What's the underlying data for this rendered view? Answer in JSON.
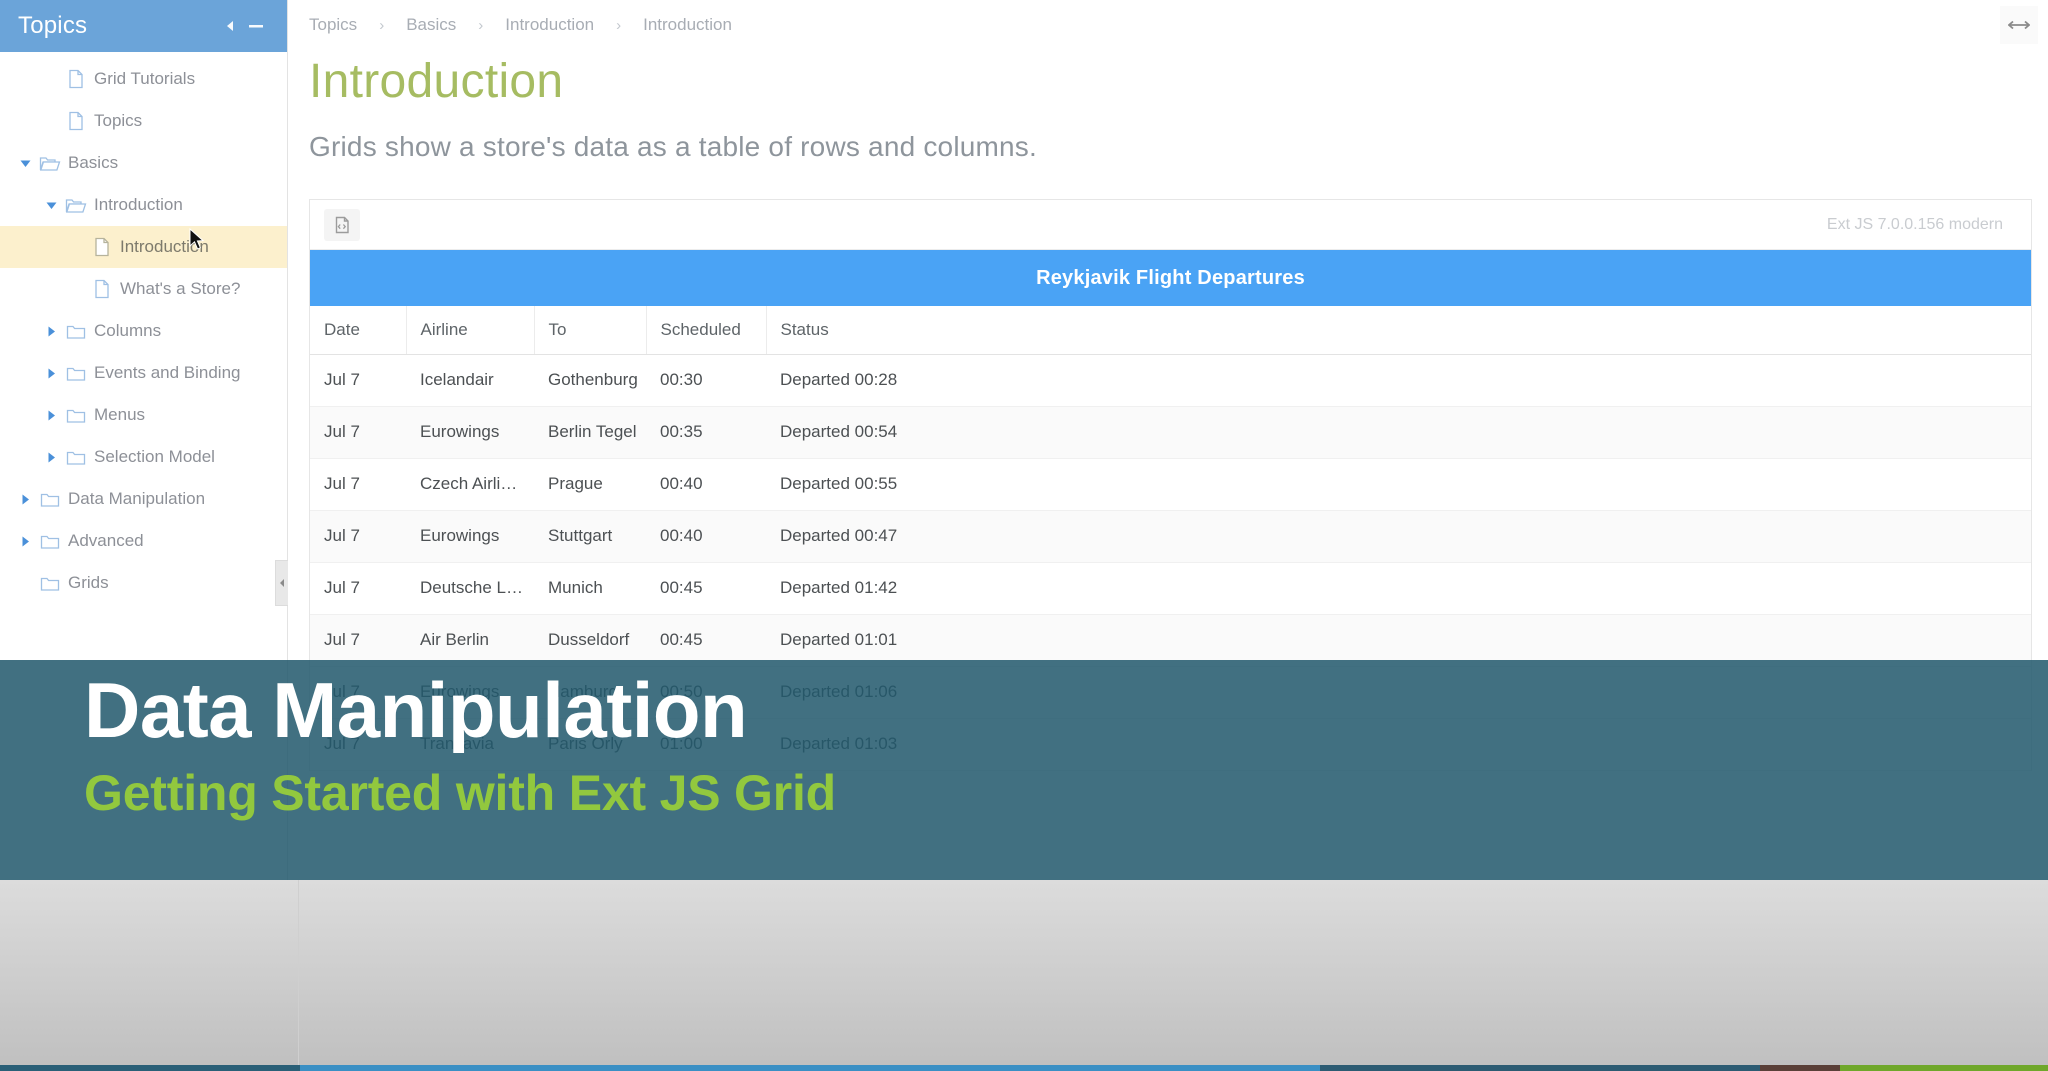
{
  "sidebar": {
    "title": "Topics",
    "collapse_icon": "caret-left-icon",
    "minimize_icon": "minus-icon",
    "collapse_handle_icon": "caret-left-icon",
    "items": [
      {
        "label": "Grid Tutorials",
        "icon": "file-icon",
        "indent": 1,
        "arrow": "none",
        "selected": false
      },
      {
        "label": "Topics",
        "icon": "file-icon",
        "indent": 1,
        "arrow": "none",
        "selected": false
      },
      {
        "label": "Basics",
        "icon": "folder-open-icon",
        "indent": 0,
        "arrow": "expanded",
        "selected": false
      },
      {
        "label": "Introduction",
        "icon": "folder-open-icon",
        "indent": 1,
        "arrow": "expanded",
        "selected": false
      },
      {
        "label": "Introduction",
        "icon": "file-icon",
        "indent": 2,
        "arrow": "none",
        "selected": true
      },
      {
        "label": "What's a Store?",
        "icon": "file-icon",
        "indent": 2,
        "arrow": "none",
        "selected": false
      },
      {
        "label": "Columns",
        "icon": "folder-icon",
        "indent": 1,
        "arrow": "collapsed",
        "selected": false
      },
      {
        "label": "Events and Binding",
        "icon": "folder-icon",
        "indent": 1,
        "arrow": "collapsed",
        "selected": false
      },
      {
        "label": "Menus",
        "icon": "folder-icon",
        "indent": 1,
        "arrow": "collapsed",
        "selected": false
      },
      {
        "label": "Selection Model",
        "icon": "folder-icon",
        "indent": 1,
        "arrow": "collapsed",
        "selected": false
      },
      {
        "label": "Data Manipulation",
        "icon": "folder-icon",
        "indent": 0,
        "arrow": "collapsed",
        "selected": false
      },
      {
        "label": "Advanced",
        "icon": "folder-icon",
        "indent": 0,
        "arrow": "collapsed",
        "selected": false
      },
      {
        "label": "Grids",
        "icon": "folder-icon",
        "indent": 0,
        "arrow": "none",
        "selected": false
      }
    ]
  },
  "breadcrumb": {
    "separator": "›",
    "items": [
      "Topics",
      "Basics",
      "Introduction",
      "Introduction"
    ]
  },
  "topbar": {
    "resize_icon": "horizontal-resize-icon"
  },
  "doc": {
    "title": "Introduction",
    "subtitle": "Grids show a store's data as a table of rows and columns."
  },
  "example": {
    "code_button_icon": "file-code-icon",
    "version_label": "Ext JS 7.0.0.156 modern"
  },
  "grid": {
    "title": "Reykjavik Flight Departures",
    "accent_color": "#4aa3f5",
    "columns": [
      "Date",
      "Airline",
      "To",
      "Scheduled",
      "Status"
    ],
    "rows": [
      [
        "Jul 7",
        "Icelandair",
        "Gothenburg",
        "00:30",
        "Departed 00:28"
      ],
      [
        "Jul 7",
        "Eurowings",
        "Berlin Tegel",
        "00:35",
        "Departed 00:54"
      ],
      [
        "Jul 7",
        "Czech Airli…",
        "Prague",
        "00:40",
        "Departed 00:55"
      ],
      [
        "Jul 7",
        "Eurowings",
        "Stuttgart",
        "00:40",
        "Departed 00:47"
      ],
      [
        "Jul 7",
        "Deutsche L…",
        "Munich",
        "00:45",
        "Departed 01:42"
      ],
      [
        "Jul 7",
        "Air Berlin",
        "Dusseldorf",
        "00:45",
        "Departed 01:01"
      ],
      [
        "Jul 7",
        "Eurowings",
        "Hamburg",
        "00:50",
        "Departed 01:06"
      ],
      [
        "Jul 7",
        "Transavia",
        "Paris Orly",
        "01:00",
        "Departed 01:03"
      ]
    ]
  },
  "lower_third": {
    "title": "Data Manipulation",
    "subtitle": "Getting Started with Ext JS Grid",
    "background_color": "#22586c",
    "subtitle_color": "#92c83e"
  }
}
